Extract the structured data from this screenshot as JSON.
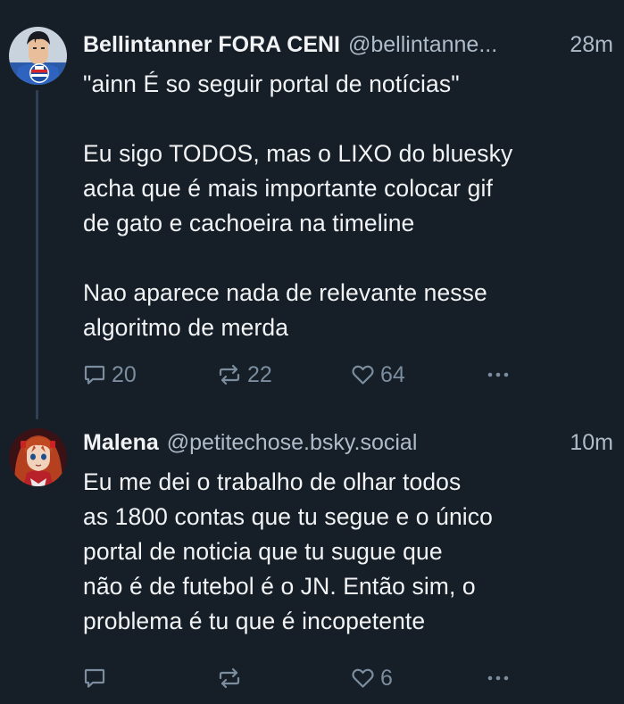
{
  "posts": [
    {
      "author": {
        "display_name": "Bellintanner FORA CENI",
        "handle": "@bellintanne..."
      },
      "time": "28m",
      "text": "\"ainn É so seguir portal de notícias\"\n\nEu sigo TODOS, mas o LIXO do bluesky\nacha que é mais importante colocar gif\nde gato e cachoeira na timeline\n\nNao aparece nada de relevante nesse\nalgoritmo de merda",
      "replies": "20",
      "reposts": "22",
      "likes": "64"
    },
    {
      "author": {
        "display_name": "Malena",
        "handle": "@petitechose.bsky.social"
      },
      "time": "10m",
      "text": "Eu me dei o trabalho de olhar todos\nas 1800 contas que tu segue e o único\nportal de noticia que tu sugue que\nnão é de futebol é o JN. Então sim, o\nproblema é tu que é incopetente",
      "replies": "",
      "reposts": "",
      "likes": "6"
    }
  ],
  "colors": {
    "background": "#161e27",
    "text_primary": "#f1f3f5",
    "text_secondary": "#aebbc9",
    "icon_muted": "#7b8d9e",
    "thread_line": "#2e4052"
  },
  "icons": {
    "reply": "speech-bubble-icon",
    "repost": "repost-arrows-icon",
    "like": "heart-outline-icon",
    "more": "ellipsis-icon"
  }
}
